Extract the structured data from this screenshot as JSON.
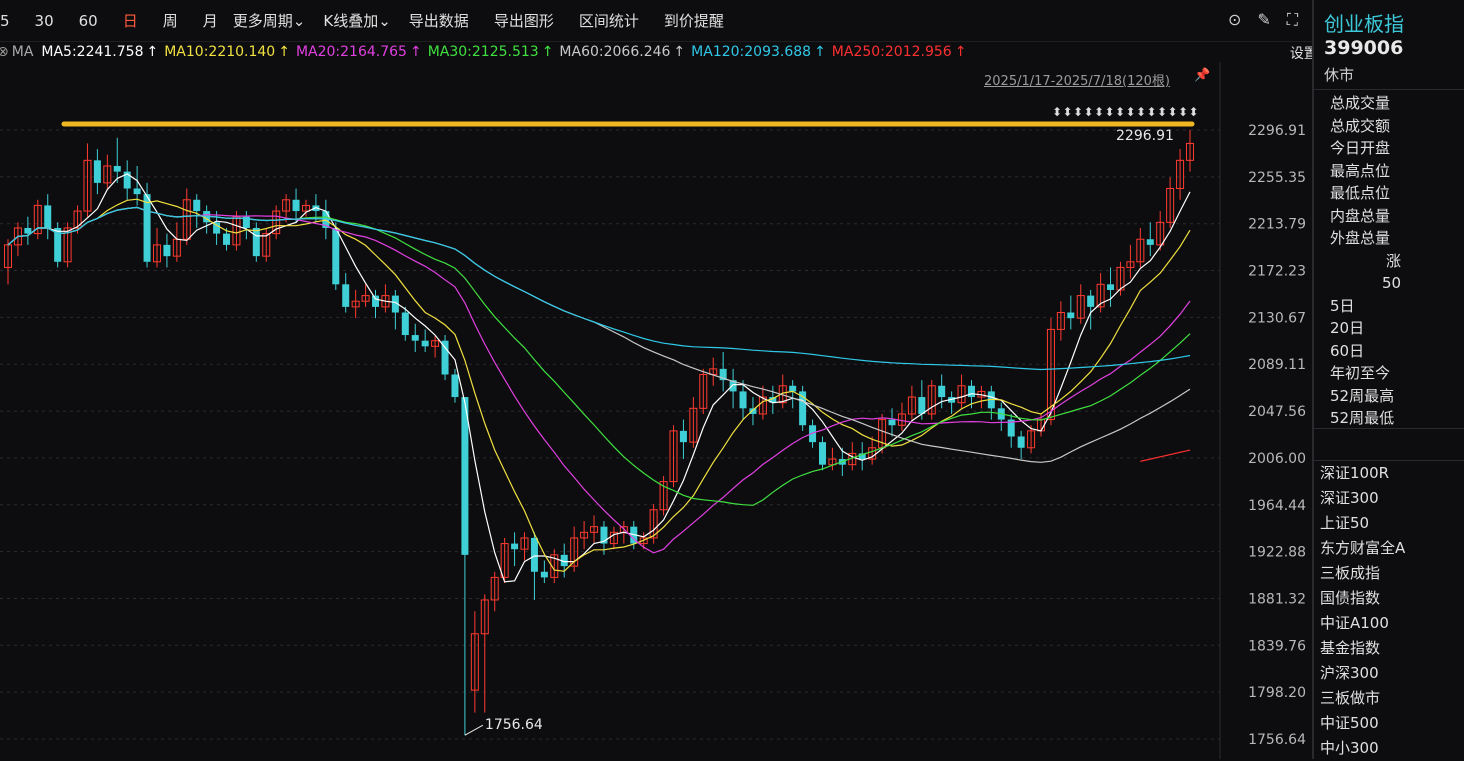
{
  "toolbar": {
    "periods": [
      "5",
      "30",
      "60",
      "日",
      "周",
      "月"
    ],
    "active_period": "日",
    "more_period": "更多周期",
    "kline_overlay": "K线叠加",
    "export_data": "导出数据",
    "export_image": "导出图形",
    "range_stats": "区间统计",
    "price_alert": "到价提醒"
  },
  "ma_bar": {
    "prefix": "MA",
    "items": [
      {
        "label": "MA5:2241.758",
        "color": "#ffffff"
      },
      {
        "label": "MA10:2210.140",
        "color": "#f0e040"
      },
      {
        "label": "MA20:2164.765",
        "color": "#e040e0"
      },
      {
        "label": "MA30:2125.513",
        "color": "#40e040"
      },
      {
        "label": "MA60:2066.246",
        "color": "#c8c8c8"
      },
      {
        "label": "MA120:2093.688",
        "color": "#30c8e8"
      },
      {
        "label": "MA250:2012.956",
        "color": "#ff3030"
      }
    ],
    "setting": "设置均线"
  },
  "range_label": "2025/1/17-2025/7/18(120根)",
  "chart_data": {
    "type": "candlestick",
    "y_ticks": [
      "2296.91",
      "2255.35",
      "2213.79",
      "2172.23",
      "2130.67",
      "2089.11",
      "2047.56",
      "2006.00",
      "1964.44",
      "1922.88",
      "1881.32",
      "1839.76",
      "1798.20",
      "1756.64"
    ],
    "ylim": [
      1756.64,
      2296.91
    ],
    "high_label": "2296.91",
    "low_label": "1756.64",
    "candles": [
      [
        2175,
        2195,
        2160,
        2200
      ],
      [
        2195,
        2210,
        2185,
        2215
      ],
      [
        2210,
        2205,
        2195,
        2220
      ],
      [
        2205,
        2230,
        2200,
        2235
      ],
      [
        2230,
        2210,
        2200,
        2240
      ],
      [
        2210,
        2180,
        2175,
        2215
      ],
      [
        2180,
        2210,
        2175,
        2215
      ],
      [
        2210,
        2225,
        2205,
        2230
      ],
      [
        2225,
        2270,
        2220,
        2285
      ],
      [
        2270,
        2250,
        2240,
        2280
      ],
      [
        2250,
        2265,
        2245,
        2275
      ],
      [
        2265,
        2260,
        2250,
        2290
      ],
      [
        2260,
        2245,
        2235,
        2270
      ],
      [
        2245,
        2240,
        2230,
        2265
      ],
      [
        2240,
        2180,
        2175,
        2250
      ],
      [
        2180,
        2195,
        2175,
        2210
      ],
      [
        2195,
        2185,
        2175,
        2205
      ],
      [
        2185,
        2200,
        2180,
        2215
      ],
      [
        2200,
        2235,
        2195,
        2245
      ],
      [
        2235,
        2225,
        2210,
        2240
      ],
      [
        2225,
        2215,
        2205,
        2230
      ],
      [
        2215,
        2205,
        2195,
        2225
      ],
      [
        2205,
        2195,
        2190,
        2210
      ],
      [
        2195,
        2220,
        2190,
        2225
      ],
      [
        2220,
        2210,
        2200,
        2225
      ],
      [
        2210,
        2185,
        2180,
        2215
      ],
      [
        2185,
        2205,
        2180,
        2210
      ],
      [
        2205,
        2225,
        2200,
        2230
      ],
      [
        2225,
        2235,
        2215,
        2240
      ],
      [
        2235,
        2225,
        2215,
        2245
      ],
      [
        2225,
        2230,
        2220,
        2235
      ],
      [
        2230,
        2225,
        2215,
        2240
      ],
      [
        2225,
        2210,
        2200,
        2235
      ],
      [
        2210,
        2160,
        2155,
        2215
      ],
      [
        2160,
        2140,
        2135,
        2170
      ],
      [
        2140,
        2145,
        2130,
        2155
      ],
      [
        2145,
        2150,
        2140,
        2160
      ],
      [
        2150,
        2140,
        2130,
        2155
      ],
      [
        2140,
        2150,
        2135,
        2160
      ],
      [
        2150,
        2135,
        2120,
        2155
      ],
      [
        2135,
        2115,
        2110,
        2140
      ],
      [
        2115,
        2110,
        2100,
        2125
      ],
      [
        2110,
        2105,
        2100,
        2120
      ],
      [
        2105,
        2110,
        2095,
        2115
      ],
      [
        2110,
        2080,
        2075,
        2115
      ],
      [
        2080,
        2060,
        2055,
        2085
      ],
      [
        2060,
        1920,
        1760,
        2050
      ],
      [
        1800,
        1850,
        1780,
        1870
      ],
      [
        1850,
        1880,
        1780,
        1885
      ],
      [
        1880,
        1900,
        1870,
        1905
      ],
      [
        1900,
        1930,
        1895,
        1935
      ],
      [
        1930,
        1925,
        1910,
        1940
      ],
      [
        1925,
        1935,
        1915,
        1940
      ],
      [
        1935,
        1905,
        1880,
        1940
      ],
      [
        1905,
        1900,
        1895,
        1915
      ],
      [
        1900,
        1920,
        1895,
        1925
      ],
      [
        1920,
        1910,
        1900,
        1930
      ],
      [
        1910,
        1935,
        1905,
        1945
      ],
      [
        1935,
        1940,
        1925,
        1950
      ],
      [
        1940,
        1945,
        1930,
        1955
      ],
      [
        1945,
        1930,
        1920,
        1950
      ],
      [
        1930,
        1940,
        1925,
        1945
      ],
      [
        1940,
        1945,
        1930,
        1950
      ],
      [
        1945,
        1930,
        1925,
        1950
      ],
      [
        1930,
        1935,
        1925,
        1940
      ],
      [
        1935,
        1960,
        1930,
        1965
      ],
      [
        1960,
        1985,
        1955,
        1990
      ],
      [
        1985,
        2030,
        1980,
        2035
      ],
      [
        2030,
        2020,
        2005,
        2040
      ],
      [
        2020,
        2050,
        2015,
        2060
      ],
      [
        2050,
        2080,
        2045,
        2085
      ],
      [
        2080,
        2085,
        2070,
        2095
      ],
      [
        2085,
        2075,
        2065,
        2100
      ],
      [
        2075,
        2065,
        2050,
        2085
      ],
      [
        2065,
        2050,
        2040,
        2075
      ],
      [
        2050,
        2045,
        2035,
        2060
      ],
      [
        2045,
        2060,
        2040,
        2070
      ],
      [
        2060,
        2055,
        2045,
        2070
      ],
      [
        2055,
        2070,
        2050,
        2080
      ],
      [
        2070,
        2065,
        2050,
        2075
      ],
      [
        2065,
        2035,
        2030,
        2070
      ],
      [
        2035,
        2020,
        2015,
        2040
      ],
      [
        2020,
        2000,
        1995,
        2025
      ],
      [
        2000,
        2005,
        1995,
        2015
      ],
      [
        2005,
        2000,
        1990,
        2015
      ],
      [
        2000,
        2010,
        1995,
        2020
      ],
      [
        2010,
        2005,
        1995,
        2020
      ],
      [
        2005,
        2015,
        2000,
        2025
      ],
      [
        2015,
        2040,
        2010,
        2045
      ],
      [
        2040,
        2035,
        2025,
        2050
      ],
      [
        2035,
        2045,
        2030,
        2055
      ],
      [
        2045,
        2060,
        2040,
        2070
      ],
      [
        2060,
        2045,
        2040,
        2075
      ],
      [
        2045,
        2070,
        2040,
        2075
      ],
      [
        2070,
        2060,
        2050,
        2080
      ],
      [
        2060,
        2055,
        2045,
        2065
      ],
      [
        2055,
        2070,
        2050,
        2080
      ],
      [
        2070,
        2060,
        2050,
        2075
      ],
      [
        2060,
        2065,
        2050,
        2070
      ],
      [
        2065,
        2050,
        2040,
        2070
      ],
      [
        2050,
        2040,
        2030,
        2055
      ],
      [
        2040,
        2025,
        2015,
        2045
      ],
      [
        2025,
        2015,
        2005,
        2030
      ],
      [
        2015,
        2030,
        2010,
        2035
      ],
      [
        2030,
        2040,
        2025,
        2045
      ],
      [
        2040,
        2120,
        2035,
        2130
      ],
      [
        2120,
        2135,
        2110,
        2145
      ],
      [
        2135,
        2130,
        2120,
        2150
      ],
      [
        2130,
        2150,
        2125,
        2160
      ],
      [
        2150,
        2140,
        2120,
        2155
      ],
      [
        2140,
        2160,
        2135,
        2170
      ],
      [
        2160,
        2155,
        2140,
        2175
      ],
      [
        2155,
        2175,
        2150,
        2180
      ],
      [
        2175,
        2180,
        2165,
        2195
      ],
      [
        2180,
        2200,
        2175,
        2210
      ],
      [
        2200,
        2195,
        2185,
        2215
      ],
      [
        2195,
        2215,
        2190,
        2225
      ],
      [
        2215,
        2245,
        2210,
        2255
      ],
      [
        2245,
        2270,
        2235,
        2280
      ],
      [
        2270,
        2285,
        2260,
        2296.91
      ]
    ]
  },
  "sidebar": {
    "name": "创业板指",
    "code": "399006",
    "status": "休市",
    "stats": [
      "总成交量",
      "总成交额",
      "今日开盘",
      "最高点位",
      "最低点位",
      "内盘总量",
      "外盘总量"
    ],
    "up_label": "涨",
    "up_value": "50",
    "periods": [
      "5日",
      "20日",
      "60日",
      "年初至今",
      "52周最高",
      "52周最低"
    ],
    "index_list": [
      "深证100R",
      "深证300",
      "上证50",
      "东方财富全A",
      "三板成指",
      "国债指数",
      "中证A100",
      "基金指数",
      "沪深300",
      "三板做市",
      "中证500",
      "中小300"
    ]
  }
}
